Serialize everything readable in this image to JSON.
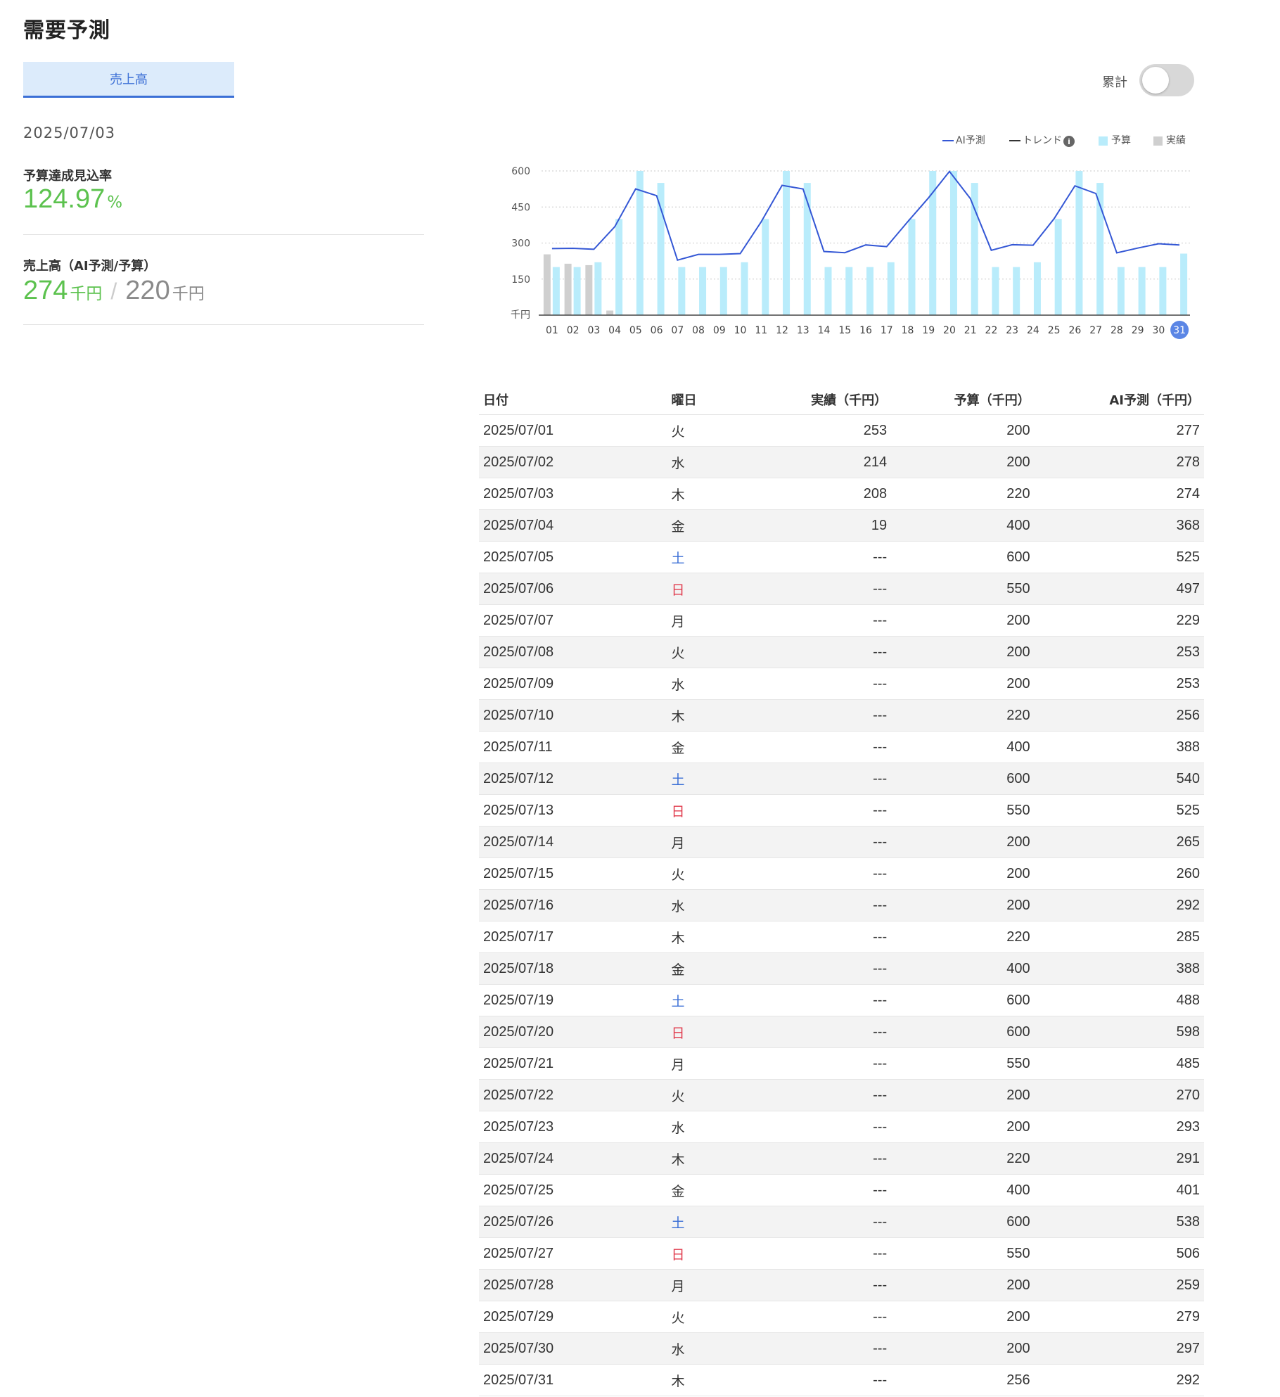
{
  "page": {
    "title": "需要予測"
  },
  "metric_tab": {
    "label": "売上高"
  },
  "report": {
    "date": "2025/07/03"
  },
  "kpi": {
    "achievement_label": "予算達成見込率",
    "achievement_value": "124.97",
    "achievement_unit": "%",
    "sales_label": "売上高（AI予測/予算）",
    "sales_forecast": "274",
    "sales_budget": "220",
    "unit": "千円",
    "separator": "/"
  },
  "toggle": {
    "label": "累計",
    "on": false
  },
  "colors": {
    "accent": "#3b6fd6",
    "green": "#5cc24e",
    "budget_bar": "#b9ecfb",
    "actual_bar": "#cfcfcf",
    "forecast_line": "#3457d5",
    "trend_line": "#333333",
    "saturday": "#3b6fd6",
    "sunday": "#e03b4d"
  },
  "chart_data": {
    "type": "bar",
    "categories": [
      "01",
      "02",
      "03",
      "04",
      "05",
      "06",
      "07",
      "08",
      "09",
      "10",
      "11",
      "12",
      "13",
      "14",
      "15",
      "16",
      "17",
      "18",
      "19",
      "20",
      "21",
      "22",
      "23",
      "24",
      "25",
      "26",
      "27",
      "28",
      "29",
      "30",
      "31"
    ],
    "highlighted_category": "31",
    "ylabel": "千円",
    "ylim": [
      0,
      600
    ],
    "yticks": [
      "600",
      "450",
      "300",
      "150"
    ],
    "grid": true,
    "legend_position": "top-right",
    "legend": {
      "forecast": "AI予測",
      "trend": "トレンド",
      "budget": "予算",
      "actual": "実績",
      "info_icon": "info-icon"
    },
    "series": [
      {
        "name": "実績",
        "kind": "bar",
        "values": [
          253,
          214,
          208,
          19,
          null,
          null,
          null,
          null,
          null,
          null,
          null,
          null,
          null,
          null,
          null,
          null,
          null,
          null,
          null,
          null,
          null,
          null,
          null,
          null,
          null,
          null,
          null,
          null,
          null,
          null,
          null
        ]
      },
      {
        "name": "予算",
        "kind": "bar",
        "values": [
          200,
          200,
          220,
          400,
          600,
          550,
          200,
          200,
          200,
          220,
          400,
          600,
          550,
          200,
          200,
          200,
          220,
          400,
          600,
          600,
          550,
          200,
          200,
          220,
          400,
          600,
          550,
          200,
          200,
          200,
          256
        ]
      },
      {
        "name": "AI予測",
        "kind": "line",
        "values": [
          277,
          278,
          274,
          368,
          525,
          497,
          229,
          253,
          253,
          256,
          388,
          540,
          525,
          265,
          260,
          292,
          285,
          388,
          488,
          598,
          485,
          270,
          293,
          291,
          401,
          538,
          506,
          259,
          279,
          297,
          292
        ]
      }
    ]
  },
  "table": {
    "headers": {
      "date": "日付",
      "weekday": "曜日",
      "actual": "実績（千円）",
      "budget": "予算（千円）",
      "forecast": "AI予測（千円）"
    },
    "rows": [
      {
        "date": "2025/07/01",
        "weekday": "火",
        "actual": "253",
        "budget": "200",
        "forecast": "277"
      },
      {
        "date": "2025/07/02",
        "weekday": "水",
        "actual": "214",
        "budget": "200",
        "forecast": "278"
      },
      {
        "date": "2025/07/03",
        "weekday": "木",
        "actual": "208",
        "budget": "220",
        "forecast": "274"
      },
      {
        "date": "2025/07/04",
        "weekday": "金",
        "actual": "19",
        "budget": "400",
        "forecast": "368"
      },
      {
        "date": "2025/07/05",
        "weekday": "土",
        "actual": "---",
        "budget": "600",
        "forecast": "525"
      },
      {
        "date": "2025/07/06",
        "weekday": "日",
        "actual": "---",
        "budget": "550",
        "forecast": "497"
      },
      {
        "date": "2025/07/07",
        "weekday": "月",
        "actual": "---",
        "budget": "200",
        "forecast": "229"
      },
      {
        "date": "2025/07/08",
        "weekday": "火",
        "actual": "---",
        "budget": "200",
        "forecast": "253"
      },
      {
        "date": "2025/07/09",
        "weekday": "水",
        "actual": "---",
        "budget": "200",
        "forecast": "253"
      },
      {
        "date": "2025/07/10",
        "weekday": "木",
        "actual": "---",
        "budget": "220",
        "forecast": "256"
      },
      {
        "date": "2025/07/11",
        "weekday": "金",
        "actual": "---",
        "budget": "400",
        "forecast": "388"
      },
      {
        "date": "2025/07/12",
        "weekday": "土",
        "actual": "---",
        "budget": "600",
        "forecast": "540"
      },
      {
        "date": "2025/07/13",
        "weekday": "日",
        "actual": "---",
        "budget": "550",
        "forecast": "525"
      },
      {
        "date": "2025/07/14",
        "weekday": "月",
        "actual": "---",
        "budget": "200",
        "forecast": "265"
      },
      {
        "date": "2025/07/15",
        "weekday": "火",
        "actual": "---",
        "budget": "200",
        "forecast": "260"
      },
      {
        "date": "2025/07/16",
        "weekday": "水",
        "actual": "---",
        "budget": "200",
        "forecast": "292"
      },
      {
        "date": "2025/07/17",
        "weekday": "木",
        "actual": "---",
        "budget": "220",
        "forecast": "285"
      },
      {
        "date": "2025/07/18",
        "weekday": "金",
        "actual": "---",
        "budget": "400",
        "forecast": "388"
      },
      {
        "date": "2025/07/19",
        "weekday": "土",
        "actual": "---",
        "budget": "600",
        "forecast": "488"
      },
      {
        "date": "2025/07/20",
        "weekday": "日",
        "actual": "---",
        "budget": "600",
        "forecast": "598"
      },
      {
        "date": "2025/07/21",
        "weekday": "月",
        "actual": "---",
        "budget": "550",
        "forecast": "485"
      },
      {
        "date": "2025/07/22",
        "weekday": "火",
        "actual": "---",
        "budget": "200",
        "forecast": "270"
      },
      {
        "date": "2025/07/23",
        "weekday": "水",
        "actual": "---",
        "budget": "200",
        "forecast": "293"
      },
      {
        "date": "2025/07/24",
        "weekday": "木",
        "actual": "---",
        "budget": "220",
        "forecast": "291"
      },
      {
        "date": "2025/07/25",
        "weekday": "金",
        "actual": "---",
        "budget": "400",
        "forecast": "401"
      },
      {
        "date": "2025/07/26",
        "weekday": "土",
        "actual": "---",
        "budget": "600",
        "forecast": "538"
      },
      {
        "date": "2025/07/27",
        "weekday": "日",
        "actual": "---",
        "budget": "550",
        "forecast": "506"
      },
      {
        "date": "2025/07/28",
        "weekday": "月",
        "actual": "---",
        "budget": "200",
        "forecast": "259"
      },
      {
        "date": "2025/07/29",
        "weekday": "火",
        "actual": "---",
        "budget": "200",
        "forecast": "279"
      },
      {
        "date": "2025/07/30",
        "weekday": "水",
        "actual": "---",
        "budget": "200",
        "forecast": "297"
      },
      {
        "date": "2025/07/31",
        "weekday": "木",
        "actual": "---",
        "budget": "256",
        "forecast": "292"
      }
    ]
  }
}
